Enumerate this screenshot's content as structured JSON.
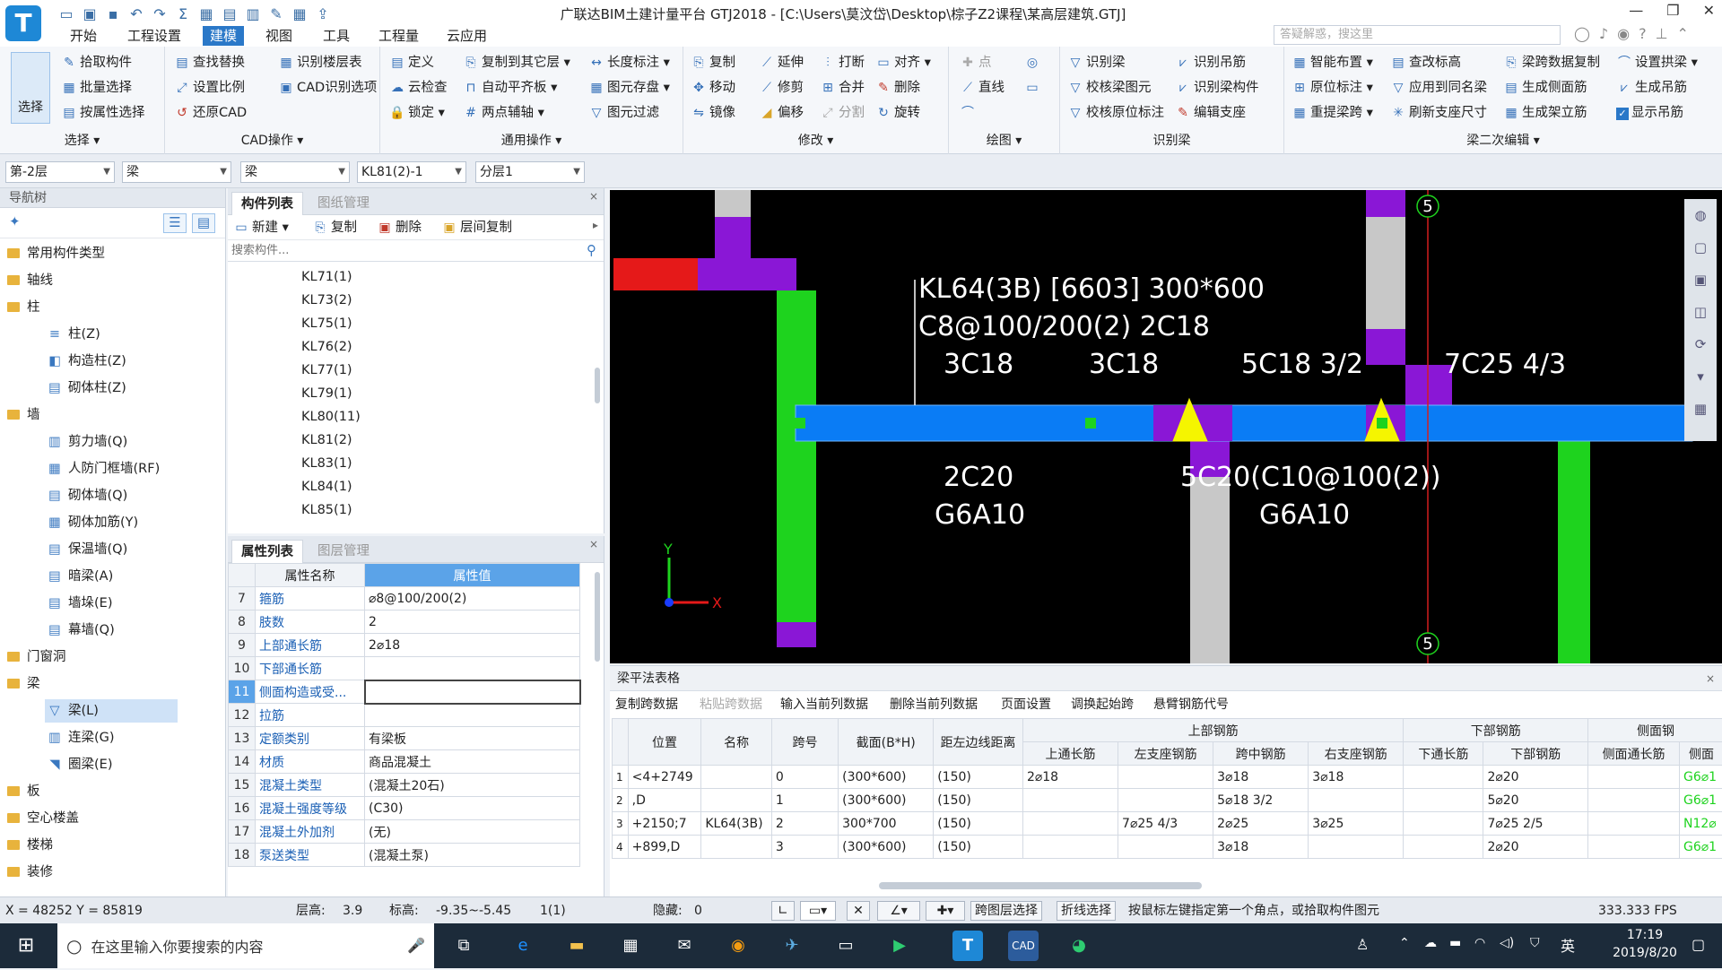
{
  "window": {
    "title": "广联达BIM土建计量平台 GTJ2018 - [C:\\Users\\莫汶岱\\Desktop\\棕子Z2课程\\某高层建筑.GTJ]",
    "search_placeholder": "答疑解惑，搜这里"
  },
  "menu": [
    {
      "label": "开始"
    },
    {
      "label": "工程设置"
    },
    {
      "label": "建模",
      "active": true
    },
    {
      "label": "视图"
    },
    {
      "label": "工具"
    },
    {
      "label": "工程量"
    },
    {
      "label": "云应用"
    }
  ],
  "ribbon": {
    "select": {
      "label": "选择",
      "group": "选择 ▾",
      "items": [
        "拾取构件",
        "批量选择",
        "按属性选择"
      ]
    },
    "cad": {
      "group": "CAD操作 ▾",
      "items": [
        "查找替换",
        "识别楼层表",
        "设置比例",
        "CAD识别选项",
        "还原CAD"
      ]
    },
    "general": {
      "group": "通用操作 ▾",
      "items": [
        "定义",
        "复制到其它层 ▾",
        "长度标注 ▾",
        "云检查",
        "自动平齐板 ▾",
        "图元存盘 ▾",
        "锁定 ▾",
        "两点辅轴 ▾",
        "图元过滤"
      ]
    },
    "modify": {
      "group": "修改 ▾",
      "items": [
        "复制",
        "延伸",
        "打断",
        "对齐 ▾",
        "移动",
        "修剪",
        "合并",
        "删除",
        "镜像",
        "偏移",
        "分割",
        "旋转"
      ]
    },
    "draw": {
      "group": "绘图 ▾",
      "items": [
        "点",
        "直线"
      ]
    },
    "identify": {
      "group": "识别梁",
      "items": [
        "识别梁",
        "识别吊筋",
        "校核梁图元",
        "识别梁构件",
        "校核原位标注",
        "编辑支座"
      ]
    },
    "secondary": {
      "group": "梁二次编辑 ▾",
      "items": [
        "智能布置 ▾",
        "查改标高",
        "梁跨数据复制",
        "设置拱梁 ▾",
        "原位标注 ▾",
        "应用到同名梁",
        "生成侧面筋",
        "生成吊筋",
        "重提梁跨 ▾",
        "刷新支座尺寸",
        "生成架立筋",
        "显示吊筋"
      ]
    }
  },
  "selectors": [
    "第-2层",
    "梁",
    "梁",
    "KL81(2)-1",
    "分层1"
  ],
  "nav": {
    "title": "导航树",
    "items": [
      {
        "label": "常用构件类型",
        "type": "folder"
      },
      {
        "label": "轴线",
        "type": "folder"
      },
      {
        "label": "柱",
        "type": "folder"
      },
      {
        "label": "柱(Z)",
        "type": "item"
      },
      {
        "label": "构造柱(Z)",
        "type": "item"
      },
      {
        "label": "砌体柱(Z)",
        "type": "item"
      },
      {
        "label": "墙",
        "type": "folder"
      },
      {
        "label": "剪力墙(Q)",
        "type": "item"
      },
      {
        "label": "人防门框墙(RF)",
        "type": "item"
      },
      {
        "label": "砌体墙(Q)",
        "type": "item"
      },
      {
        "label": "砌体加筋(Y)",
        "type": "item"
      },
      {
        "label": "保温墙(Q)",
        "type": "item"
      },
      {
        "label": "暗梁(A)",
        "type": "item"
      },
      {
        "label": "墙垛(E)",
        "type": "item"
      },
      {
        "label": "幕墙(Q)",
        "type": "item"
      },
      {
        "label": "门窗洞",
        "type": "folder"
      },
      {
        "label": "梁",
        "type": "folder"
      },
      {
        "label": "梁(L)",
        "type": "item",
        "selected": true
      },
      {
        "label": "连梁(G)",
        "type": "item"
      },
      {
        "label": "圈梁(E)",
        "type": "item"
      },
      {
        "label": "板",
        "type": "folder"
      },
      {
        "label": "空心楼盖",
        "type": "folder"
      },
      {
        "label": "楼梯",
        "type": "folder"
      },
      {
        "label": "装修",
        "type": "folder"
      }
    ]
  },
  "component_list": {
    "tabs": [
      "构件列表",
      "图纸管理"
    ],
    "tools": [
      "新建 ▾",
      "复制",
      "删除",
      "层间复制"
    ],
    "search_placeholder": "搜索构件...",
    "items": [
      "KL71(1)",
      "KL73(2)",
      "KL75(1)",
      "KL76(2)",
      "KL77(1)",
      "KL79(1)",
      "KL80(11)",
      "KL81(2)",
      "KL83(1)",
      "KL84(1)",
      "KL85(1)"
    ]
  },
  "properties": {
    "tabs": [
      "属性列表",
      "图层管理"
    ],
    "col_name": "属性名称",
    "col_value": "属性值",
    "rows": [
      {
        "n": "7",
        "name": "箍筋",
        "value": "⌀8@100/200(2)"
      },
      {
        "n": "8",
        "name": "肢数",
        "value": "2"
      },
      {
        "n": "9",
        "name": "上部通长筋",
        "value": "2⌀18"
      },
      {
        "n": "10",
        "name": "下部通长筋",
        "value": ""
      },
      {
        "n": "11",
        "name": "侧面构造或受...",
        "value": "",
        "selected": true
      },
      {
        "n": "12",
        "name": "拉筋",
        "value": ""
      },
      {
        "n": "13",
        "name": "定额类别",
        "value": "有梁板"
      },
      {
        "n": "14",
        "name": "材质",
        "value": "商品混凝土"
      },
      {
        "n": "15",
        "name": "混凝土类型",
        "value": "(混凝土20石)"
      },
      {
        "n": "16",
        "name": "混凝土强度等级",
        "value": "(C30)"
      },
      {
        "n": "17",
        "name": "混凝土外加剂",
        "value": "(无)"
      },
      {
        "n": "18",
        "name": "泵送类型",
        "value": "(混凝土泵)"
      }
    ]
  },
  "canvas": {
    "labels": {
      "line1": "KL64(3B) [6603] 300*600",
      "line2": "C8@100/200(2) 2C18",
      "top_left": "3C18",
      "top_mid": "3C18",
      "top_r1": "5C18 3/2",
      "top_r2": "7C25 4/3",
      "bot_l1": "2C20",
      "bot_l2": "G6A10",
      "bot_r1": "5C20(C10@100(2))",
      "bot_r2": "G6A10"
    },
    "axis": {
      "top": "5",
      "bottom": "5",
      "x": "X",
      "y": "Y"
    }
  },
  "beam_table": {
    "title": "梁平法表格",
    "tools": [
      "复制跨数据",
      "粘贴跨数据",
      "输入当前列数据",
      "删除当前列数据",
      "页面设置",
      "调换起始跨",
      "悬臂钢筋代号"
    ],
    "groups": {
      "top": "上部钢筋",
      "bottom": "下部钢筋",
      "side": "侧面钢"
    },
    "headers": [
      "位置",
      "名称",
      "跨号",
      "截面(B*H)",
      "距左边线距离",
      "上通长筋",
      "左支座钢筋",
      "跨中钢筋",
      "右支座钢筋",
      "下通长筋",
      "下部钢筋",
      "侧面通长筋",
      "侧面"
    ],
    "rows": [
      {
        "rn": "1",
        "pos": "<4+2749",
        "name": "",
        "span": "0",
        "sec": "(300*600)",
        "dist": "(150)",
        "top_thru": "2⌀18",
        "left": "",
        "mid": "3⌀18",
        "right": "3⌀18",
        "bot_thru": "",
        "bot": "2⌀20",
        "side_thru": "",
        "side": "G6⌀1"
      },
      {
        "rn": "2",
        "pos": ",D",
        "name": "",
        "span": "1",
        "sec": "(300*600)",
        "dist": "(150)",
        "top_thru": "",
        "left": "",
        "mid": "5⌀18 3/2",
        "right": "",
        "bot_thru": "",
        "bot": "5⌀20",
        "side_thru": "",
        "side": "G6⌀1"
      },
      {
        "rn": "3",
        "pos": "+2150;7",
        "name": "KL64(3B)",
        "span": "2",
        "sec": "300*700",
        "dist": "(150)",
        "top_thru": "",
        "left": "7⌀25 4/3",
        "mid": "2⌀25",
        "right": "3⌀25",
        "bot_thru": "",
        "bot": "7⌀25 2/5",
        "side_thru": "",
        "side": "N12⌀"
      },
      {
        "rn": "4",
        "pos": "+899,D",
        "name": "",
        "span": "3",
        "sec": "(300*600)",
        "dist": "(150)",
        "top_thru": "",
        "left": "",
        "mid": "3⌀18",
        "right": "",
        "bot_thru": "",
        "bot": "2⌀20",
        "side_thru": "",
        "side": "G6⌀1"
      }
    ]
  },
  "status": {
    "coords": "X = 48252 Y = 85819",
    "floor_h_label": "层高:",
    "floor_h": "3.9",
    "elev_label": "标高:",
    "elev": "-9.35~-5.45",
    "count": "1(1)",
    "hidden_label": "隐藏:",
    "hidden": "0",
    "btn1": "跨图层选择",
    "btn2": "折线选择",
    "hint": "按鼠标左键指定第一个角点，或拾取构件图元",
    "fps": "333.333 FPS"
  },
  "taskbar": {
    "search": "在这里输入你要搜索的内容",
    "time": "17:19",
    "date": "2019/8/20",
    "lang": "英"
  }
}
